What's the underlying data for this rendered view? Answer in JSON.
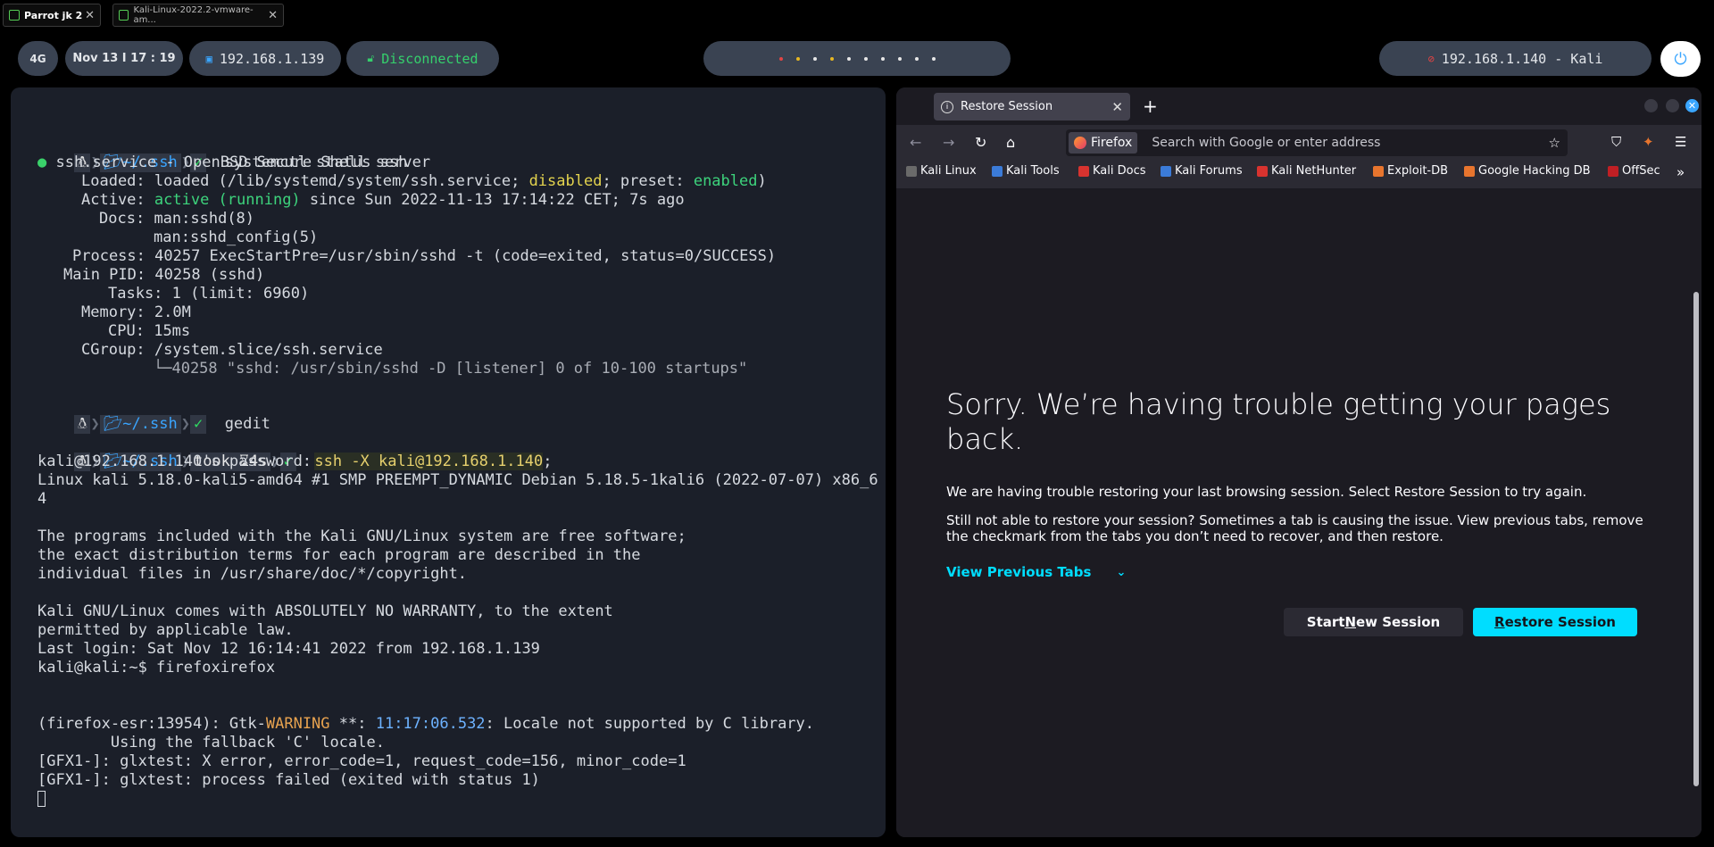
{
  "vm_tabs": [
    {
      "label": "Parrot jk 2"
    },
    {
      "label": "Kali-Linux-2022.2-vmware-am..."
    }
  ],
  "desktop_bar": {
    "workspace": "4G",
    "clock": "Nov 13  I  17 : 19",
    "local_ip": "192.168.1.139",
    "vpn_status": "Disconnected",
    "target": "192.168.1.140 - Kali"
  },
  "terminal": {
    "prompt_dir": "~/.ssh",
    "cmd1": "systemctl status ssh",
    "status": {
      "service": "ssh.service - OpenBSD Secure Shell server",
      "loaded_label": "Loaded:",
      "loaded_value": "loaded (/lib/systemd/system/ssh.service;",
      "loaded_disabled": "disabled",
      "loaded_preset": "; preset:",
      "loaded_enabled": "enabled",
      "loaded_close": ")",
      "active_label": "Active:",
      "active_value": "active (running)",
      "active_since": "since Sun 2022-11-13 17:14:22 CET; 7s ago",
      "docs_label": "Docs:",
      "docs1": "man:sshd(8)",
      "docs2": "man:sshd_config(5)",
      "process_label": "Process:",
      "process_value": "40257 ExecStartPre=/usr/sbin/sshd -t (code=exited, status=0/SUCCESS)",
      "pid_label": "Main PID:",
      "pid_value": "40258 (sshd)",
      "tasks_label": "Tasks:",
      "tasks_value": "1 (limit: 6960)",
      "memory_label": "Memory:",
      "memory_value": "2.0M",
      "cpu_label": "CPU:",
      "cpu_value": "15ms",
      "cgroup_label": "CGroup:",
      "cgroup_value": "/system.slice/ssh.service",
      "cgroup_child": "└─40258 \"sshd: /usr/sbin/sshd -D [listener] 0 of 10-100 startups\""
    },
    "cmd2": "gedit",
    "took_label": "took",
    "took_value": "4s",
    "cmd3": "ssh -X kali@192.168.1.140",
    "cmd3_tail": ";",
    "output": [
      "kali@192.168.1.140's password:",
      "Linux kali 5.18.0-kali5-amd64 #1 SMP PREEMPT_DYNAMIC Debian 5.18.5-1kali6 (2022-07-07) x86_6",
      "4",
      "",
      "The programs included with the Kali GNU/Linux system are free software;",
      "the exact distribution terms for each program are described in the",
      "individual files in /usr/share/doc/*/copyright.",
      "",
      "Kali GNU/Linux comes with ABSOLUTELY NO WARRANTY, to the extent",
      "permitted by applicable law.",
      "Last login: Sat Nov 12 16:14:41 2022 from 192.168.1.139",
      "kali@kali:~$ firefoxirefox"
    ],
    "gtk_prefix": "(firefox-esr:13954): Gtk-",
    "gtk_warning": "WARNING",
    "gtk_stars": " **: ",
    "gtk_time": "11:17:06.532",
    "gtk_msg": ": Locale not supported by C library.",
    "gtk_fallback": "        Using the fallback 'C' locale.",
    "gfx1": "[GFX1-]: glxtest: X error, error_code=1, request_code=156, minor_code=1",
    "gfx2": "[GFX1-]: glxtest: process failed (exited with status 1)"
  },
  "firefox": {
    "tab_title": "Restore Session",
    "identity_label": "Firefox",
    "url_placeholder": "Search with Google or enter address",
    "bookmarks": [
      {
        "label": "Kali Linux",
        "color": "#6a6a6a"
      },
      {
        "label": "Kali Tools",
        "color": "#3b7bd8"
      },
      {
        "label": "Kali Docs",
        "color": "#d8332f"
      },
      {
        "label": "Kali Forums",
        "color": "#3b7bd8"
      },
      {
        "label": "Kali NetHunter",
        "color": "#d8332f"
      },
      {
        "label": "Exploit-DB",
        "color": "#e8752e"
      },
      {
        "label": "Google Hacking DB",
        "color": "#e8752e"
      },
      {
        "label": "OffSec",
        "color": "#c01f24"
      }
    ],
    "heading": "Sorry. We’re having trouble getting your pages back.",
    "p1": "We are having trouble restoring your last browsing session. Select Restore Session to try again.",
    "p2": "Still not able to restore your session? Sometimes a tab is causing the issue. View previous tabs, remove the checkmark from the tabs you don’t need to recover, and then restore.",
    "view_previous": "View Previous Tabs",
    "start_new_pre": "Start ",
    "start_new_u": "N",
    "start_new_post": "ew Session",
    "restore_u": "R",
    "restore_post": "estore Session"
  },
  "colors": {
    "accent": "#00ddff",
    "terminal_bg": "#1b1f29",
    "pill_bg": "#3a4352",
    "vpn_disconnected": "#35d06c"
  }
}
